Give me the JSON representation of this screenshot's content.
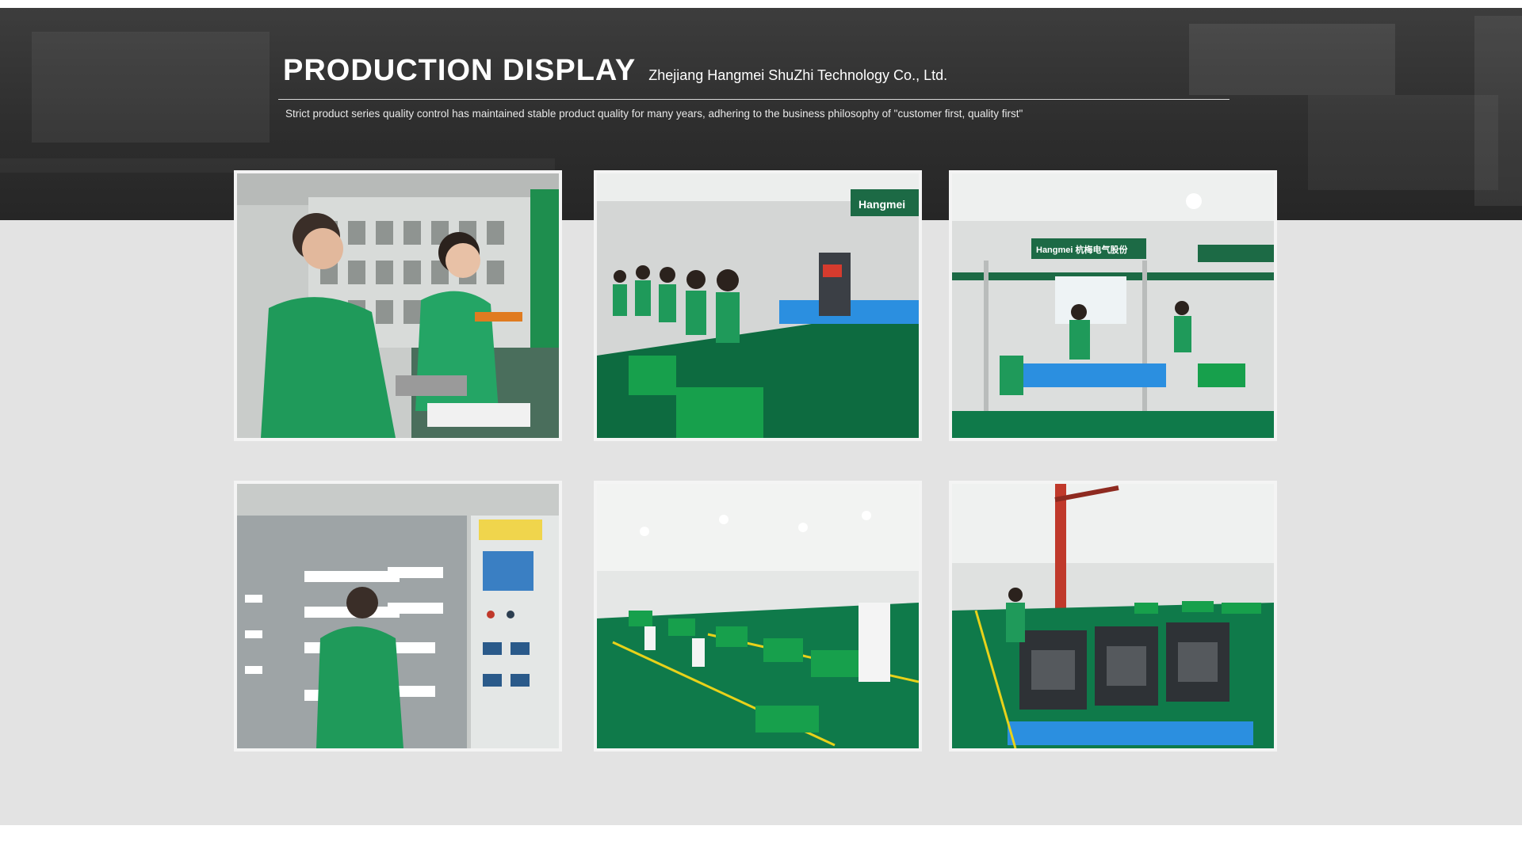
{
  "section": {
    "title": "PRODUCTION DISPLAY",
    "company": "Zhejiang Hangmei ShuZhi Technology Co., Ltd.",
    "tagline": "Strict product series quality control has maintained stable product quality for many years, adhering to the business philosophy of \"customer first, quality first\""
  },
  "photos": [
    {
      "scene": "meter-testing-workstation",
      "brand_sign": ""
    },
    {
      "scene": "assembly-line-workers",
      "brand_sign": "Hangmei"
    },
    {
      "scene": "production-racks-blue-bins",
      "brand_sign": "Hangmei 杭梅电气股份"
    },
    {
      "scene": "aging-test-cabinet",
      "brand_sign": ""
    },
    {
      "scene": "workshop-floor-overview",
      "brand_sign": ""
    },
    {
      "scene": "circuit-breaker-assembly",
      "brand_sign": ""
    }
  ],
  "colors": {
    "hero_dark": "#2e2e2e",
    "page_bg": "#e3e3e3",
    "frame": "#f4f4f4",
    "uniform_green": "#1f9a5a",
    "floor_green": "#0f7a4a",
    "bin_blue": "#2b8fe0"
  }
}
